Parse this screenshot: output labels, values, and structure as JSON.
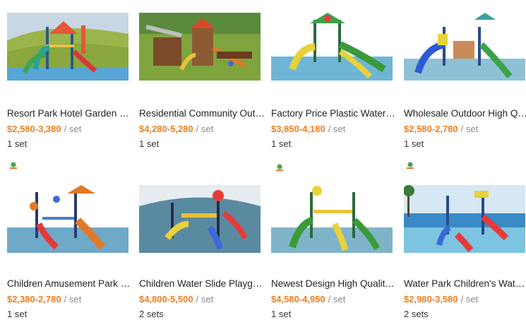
{
  "products": [
    {
      "title": "Resort Park Hotel Garden Playground Equipment",
      "price": "$2,580-3,380",
      "unit": "/ set",
      "moq": "1 set",
      "scene": "grass"
    },
    {
      "title": "Residential Community Outdoor Playground",
      "price": "$4,280-5,280",
      "unit": "/ set",
      "moq": "1 set",
      "scene": "park"
    },
    {
      "title": "Factory Price Plastic Water Slide",
      "price": "$3,850-4,180",
      "unit": "/ set",
      "moq": "1 set",
      "scene": "pool"
    },
    {
      "title": "Wholesale Outdoor High Quality Water Slide",
      "price": "$2,580-2,780",
      "unit": "/ set",
      "moq": "1 set",
      "scene": "pool"
    },
    {
      "title": "Children Amusement Park Water Playground",
      "price": "$2,380-2,780",
      "unit": "/ set",
      "moq": "1 set",
      "scene": "pool"
    },
    {
      "title": "Children Water Slide Playground Equipment",
      "price": "$4,800-5,500",
      "unit": "/ set",
      "moq": "2 sets",
      "scene": "pooldark"
    },
    {
      "title": "Newest Design High Quality Water Slide",
      "price": "$4,580-4,950",
      "unit": "/ set",
      "moq": "1 set",
      "scene": "pool"
    },
    {
      "title": "Water Park Children's Water Slide",
      "price": "$2,980-3,580",
      "unit": "/ set",
      "moq": "2 sets",
      "scene": "beach"
    }
  ],
  "colors": {
    "price": "#f07f1f",
    "unit": "#8a8a8a",
    "text": "#222222"
  }
}
